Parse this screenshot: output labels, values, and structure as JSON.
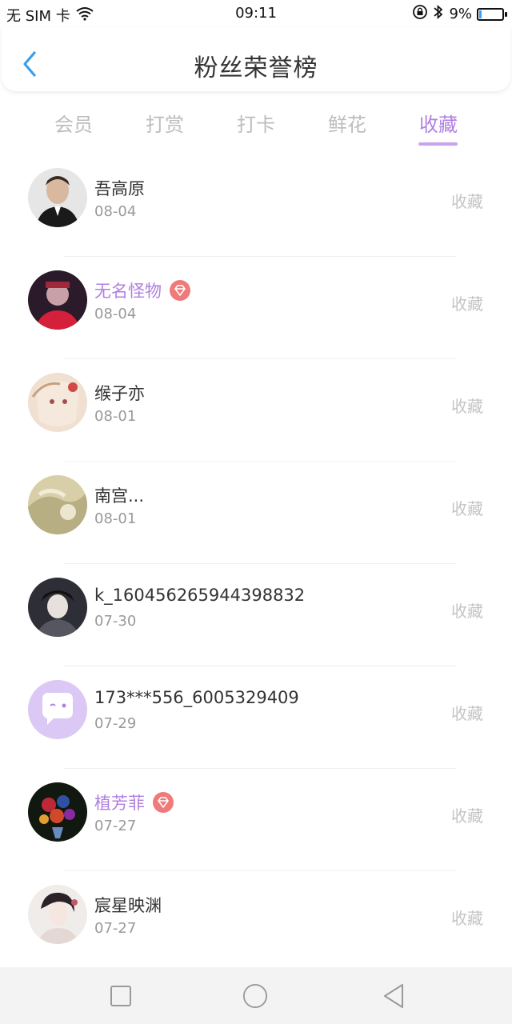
{
  "status_bar": {
    "carrier": "无 SIM 卡",
    "time": "09:11",
    "battery": "9%",
    "battery_level": 0.09
  },
  "header": {
    "title": "粉丝荣誉榜"
  },
  "tabs": [
    {
      "label": "会员",
      "active": false
    },
    {
      "label": "打赏",
      "active": false
    },
    {
      "label": "打卡",
      "active": false
    },
    {
      "label": "鲜花",
      "active": false
    },
    {
      "label": "收藏",
      "active": true
    }
  ],
  "fans": [
    {
      "name": "吾高原",
      "date": "08-04",
      "vip": false,
      "action": "收藏",
      "avatar_color": "#2b2b2b"
    },
    {
      "name": "无名怪物",
      "date": "08-04",
      "vip": true,
      "action": "收藏",
      "avatar_color": "#8a2a3a"
    },
    {
      "name": "缑子亦",
      "date": "08-01",
      "vip": false,
      "action": "收藏",
      "avatar_color": "#e9d2c4"
    },
    {
      "name": "南宫...",
      "date": "08-01",
      "vip": false,
      "action": "收藏",
      "avatar_color": "#cfc39a"
    },
    {
      "name": "k_160456265944398832",
      "date": "07-30",
      "vip": false,
      "action": "收藏",
      "avatar_color": "#3a3a44"
    },
    {
      "name": "173***556_6005329409",
      "date": "07-29",
      "vip": false,
      "action": "收藏",
      "avatar_color": "#dcc8f4"
    },
    {
      "name": "植芳菲",
      "date": "07-27",
      "vip": true,
      "action": "收藏",
      "avatar_color": "#1e3a1e"
    },
    {
      "name": "宸星映渊",
      "date": "07-27",
      "vip": false,
      "action": "收藏",
      "avatar_color": "#e8e4e2"
    }
  ],
  "colors": {
    "accent": "#b07fe0",
    "badge": "#f07a7a",
    "back_arrow": "#3a9ee8"
  }
}
